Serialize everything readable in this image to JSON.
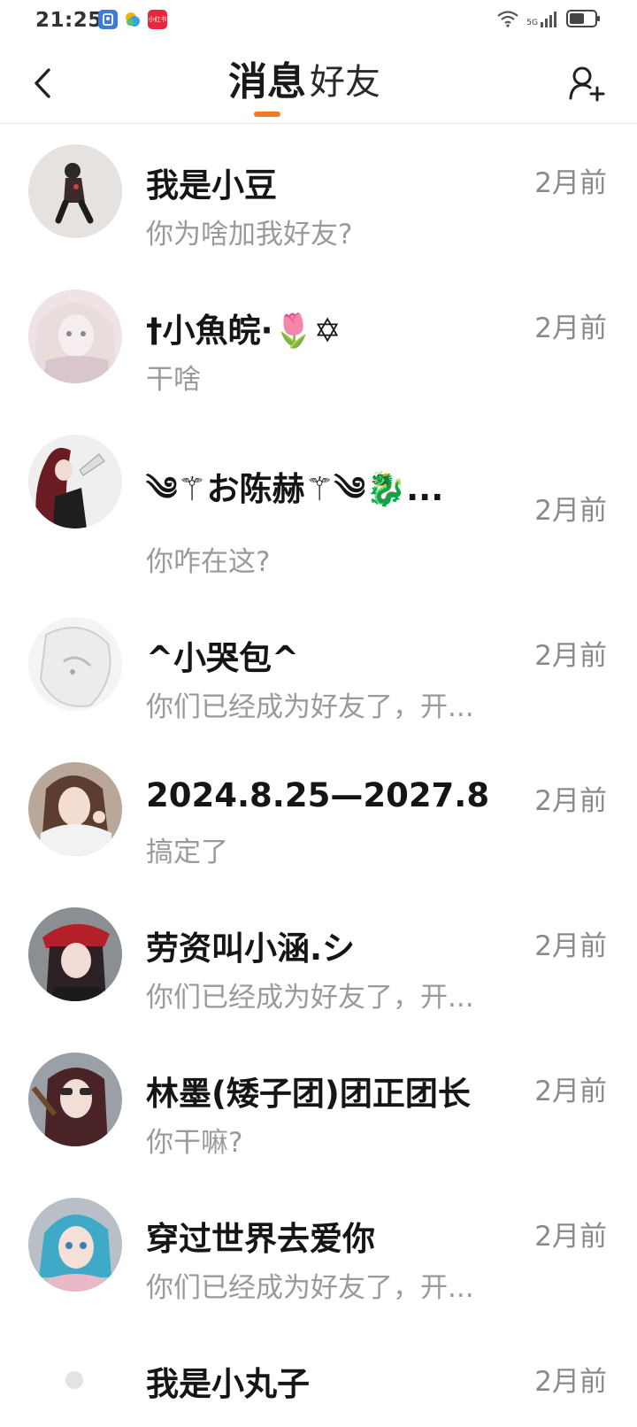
{
  "status_bar": {
    "time": "21:25",
    "network": "5G",
    "app_icons": [
      "cards-app-icon",
      "weather-app-icon",
      "xiaohongshu-app-icon"
    ],
    "red_app_label": "小红书"
  },
  "header": {
    "tabs": [
      {
        "label": "消息",
        "active": true
      },
      {
        "label": "好友",
        "active": false
      }
    ],
    "accent_color": "#f07a26"
  },
  "conversations": [
    {
      "name": "我是小豆",
      "time": "2月前",
      "message": "你为啥加我好友?"
    },
    {
      "name": "†小魚皖·🌷✡",
      "time": "2月前",
      "message": "干啥"
    },
    {
      "name": "༄⚚お陈赫⚚༄🐉...",
      "time": "2月前",
      "message": "你咋在这?"
    },
    {
      "name": "^小哭包^",
      "time": "2月前",
      "message": "你们已经成为好友了，开..."
    },
    {
      "name": "2024.8.25—2027.8",
      "time": "2月前",
      "message": "搞定了"
    },
    {
      "name": "劳资叫小涵.シ",
      "time": "2月前",
      "message": "你们已经成为好友了，开..."
    },
    {
      "name": "林墨(矮子团)团正团长",
      "time": "2月前",
      "message": "你干嘛?"
    },
    {
      "name": "穿过世界去爱你",
      "time": "2月前",
      "message": "你们已经成为好友了，开..."
    },
    {
      "name": "我是小丸子",
      "time": "2月前",
      "message": ""
    }
  ]
}
